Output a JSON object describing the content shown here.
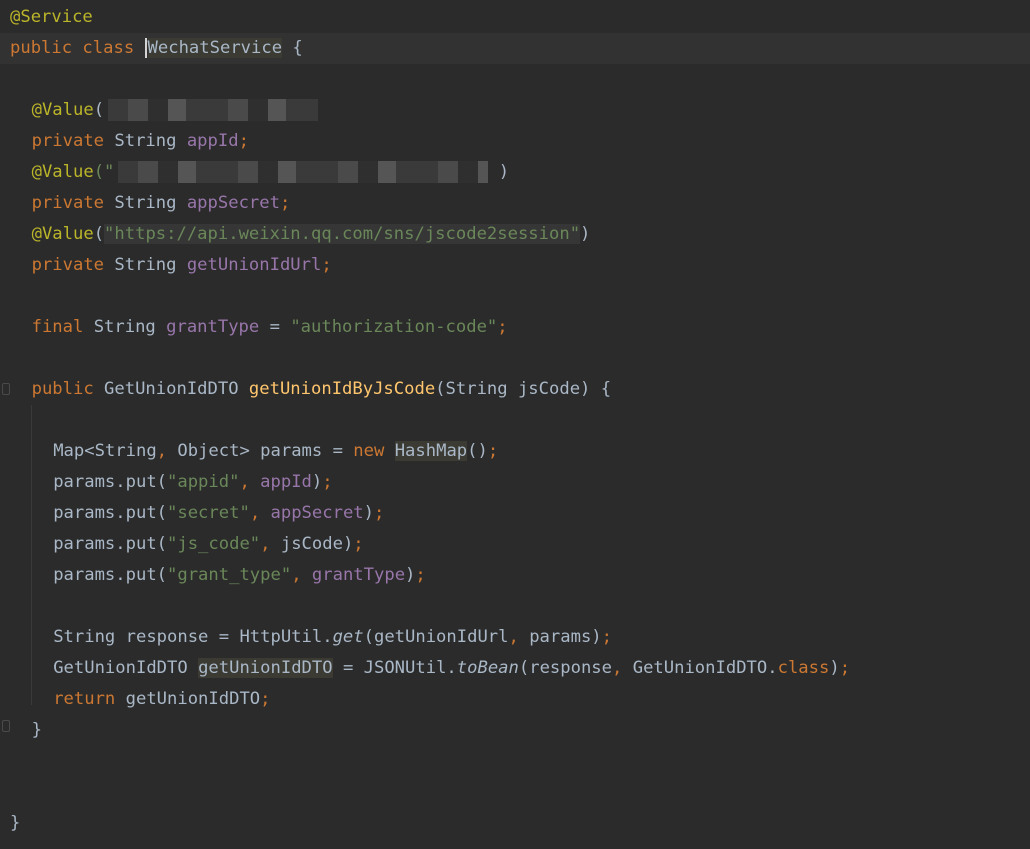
{
  "lines": [
    {
      "tokens": [
        {
          "t": "@Service",
          "c": "ann"
        }
      ]
    },
    {
      "current": true,
      "tokens": [
        {
          "t": "public class ",
          "c": "kw"
        },
        {
          "t": "WechatService",
          "c": "plain hl",
          "caret": true
        },
        {
          "t": " {",
          "c": "plain"
        }
      ]
    },
    {
      "tokens": []
    },
    {
      "indent": 2,
      "tokens": [
        {
          "t": "@Value",
          "c": "ann"
        },
        {
          "t": "(",
          "c": "plain"
        },
        {
          "redact": true
        }
      ]
    },
    {
      "indent": 2,
      "tokens": [
        {
          "t": "private ",
          "c": "kw"
        },
        {
          "t": "String ",
          "c": "plain"
        },
        {
          "t": "appId",
          "c": "fld"
        },
        {
          "t": ";",
          "c": "punc"
        }
      ]
    },
    {
      "indent": 2,
      "tokens": [
        {
          "t": "@Value",
          "c": "ann"
        },
        {
          "t": "(\"",
          "c": "str"
        },
        {
          "redact": true,
          "wide": true
        },
        {
          "t": " )",
          "c": "plain"
        }
      ]
    },
    {
      "indent": 2,
      "tokens": [
        {
          "t": "private ",
          "c": "kw"
        },
        {
          "t": "String ",
          "c": "plain"
        },
        {
          "t": "appSecret",
          "c": "fld"
        },
        {
          "t": ";",
          "c": "punc"
        }
      ]
    },
    {
      "indent": 2,
      "tokens": [
        {
          "t": "@Value",
          "c": "ann"
        },
        {
          "t": "(",
          "c": "plain"
        },
        {
          "t": "\"https://api.weixin.qq.com/sns/jscode2session\"",
          "c": "str strbg"
        },
        {
          "t": ")",
          "c": "plain"
        }
      ]
    },
    {
      "indent": 2,
      "tokens": [
        {
          "t": "private ",
          "c": "kw"
        },
        {
          "t": "String ",
          "c": "plain"
        },
        {
          "t": "getUnionIdUrl",
          "c": "fld"
        },
        {
          "t": ";",
          "c": "punc"
        }
      ]
    },
    {
      "tokens": []
    },
    {
      "indent": 2,
      "tokens": [
        {
          "t": "final ",
          "c": "kw"
        },
        {
          "t": "String ",
          "c": "plain"
        },
        {
          "t": "grantType",
          "c": "fld"
        },
        {
          "t": " = ",
          "c": "plain"
        },
        {
          "t": "\"authorization-code\"",
          "c": "str"
        },
        {
          "t": ";",
          "c": "punc"
        }
      ]
    },
    {
      "tokens": []
    },
    {
      "indent": 2,
      "tokens": [
        {
          "t": "public ",
          "c": "kw"
        },
        {
          "t": "GetUnionIdDTO ",
          "c": "plain"
        },
        {
          "t": "getUnionIdByJsCode",
          "c": "fn"
        },
        {
          "t": "(String jsCode) {",
          "c": "plain"
        }
      ]
    },
    {
      "tokens": []
    },
    {
      "indent": 4,
      "tokens": [
        {
          "t": "Map<String",
          "c": "plain"
        },
        {
          "t": ", ",
          "c": "punc"
        },
        {
          "t": "Object> params = ",
          "c": "plain"
        },
        {
          "t": "new ",
          "c": "kw"
        },
        {
          "t": "HashMap",
          "c": "plain hl"
        },
        {
          "t": "()",
          "c": "plain"
        },
        {
          "t": ";",
          "c": "punc"
        }
      ]
    },
    {
      "indent": 4,
      "tokens": [
        {
          "t": "params.put(",
          "c": "plain"
        },
        {
          "t": "\"appid\"",
          "c": "str"
        },
        {
          "t": ", ",
          "c": "punc"
        },
        {
          "t": "appId",
          "c": "fld"
        },
        {
          "t": ")",
          "c": "plain"
        },
        {
          "t": ";",
          "c": "punc"
        }
      ]
    },
    {
      "indent": 4,
      "tokens": [
        {
          "t": "params.put(",
          "c": "plain"
        },
        {
          "t": "\"secret\"",
          "c": "str"
        },
        {
          "t": ", ",
          "c": "punc"
        },
        {
          "t": "appSecret",
          "c": "fld"
        },
        {
          "t": ")",
          "c": "plain"
        },
        {
          "t": ";",
          "c": "punc"
        }
      ]
    },
    {
      "indent": 4,
      "tokens": [
        {
          "t": "params.put(",
          "c": "plain"
        },
        {
          "t": "\"js_code\"",
          "c": "str"
        },
        {
          "t": ", ",
          "c": "punc"
        },
        {
          "t": "jsCode)",
          "c": "plain"
        },
        {
          "t": ";",
          "c": "punc"
        }
      ]
    },
    {
      "indent": 4,
      "tokens": [
        {
          "t": "params.put(",
          "c": "plain"
        },
        {
          "t": "\"grant_type\"",
          "c": "str"
        },
        {
          "t": ", ",
          "c": "punc"
        },
        {
          "t": "grantType",
          "c": "fld"
        },
        {
          "t": ")",
          "c": "plain"
        },
        {
          "t": ";",
          "c": "punc"
        }
      ]
    },
    {
      "tokens": []
    },
    {
      "indent": 4,
      "tokens": [
        {
          "t": "String response = HttpUtil.",
          "c": "plain"
        },
        {
          "t": "get",
          "c": "plain it"
        },
        {
          "t": "(getUnionIdUrl",
          "c": "plain"
        },
        {
          "t": ", ",
          "c": "punc"
        },
        {
          "t": "params)",
          "c": "plain"
        },
        {
          "t": ";",
          "c": "punc"
        }
      ]
    },
    {
      "indent": 4,
      "tokens": [
        {
          "t": "GetUnionIdDTO ",
          "c": "plain"
        },
        {
          "t": "getUnionIdDTO",
          "c": "plain hl"
        },
        {
          "t": " = JSONUtil.",
          "c": "plain"
        },
        {
          "t": "toBean",
          "c": "plain it"
        },
        {
          "t": "(response",
          "c": "plain"
        },
        {
          "t": ", ",
          "c": "punc"
        },
        {
          "t": "GetUnionIdDTO.",
          "c": "plain"
        },
        {
          "t": "class",
          "c": "kw"
        },
        {
          "t": ")",
          "c": "plain"
        },
        {
          "t": ";",
          "c": "punc"
        }
      ]
    },
    {
      "indent": 4,
      "tokens": [
        {
          "t": "return ",
          "c": "kw"
        },
        {
          "t": "getUnionIdDTO",
          "c": "plain"
        },
        {
          "t": ";",
          "c": "punc"
        }
      ]
    },
    {
      "indent": 2,
      "tokens": [
        {
          "t": "}",
          "c": "plain"
        }
      ]
    },
    {
      "tokens": []
    },
    {
      "tokens": []
    },
    {
      "tokens": [
        {
          "t": "}",
          "c": "plain"
        }
      ]
    }
  ]
}
